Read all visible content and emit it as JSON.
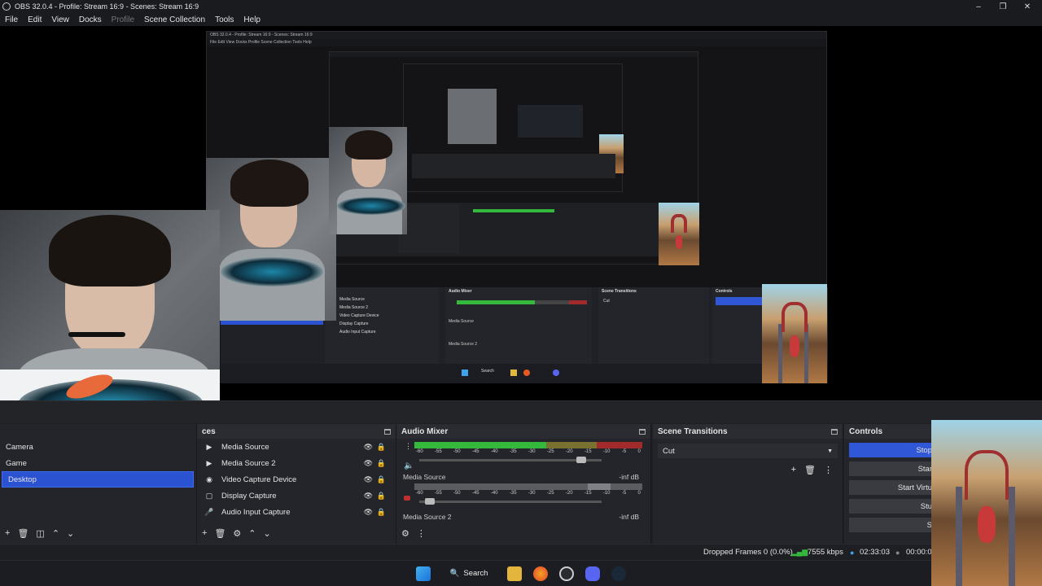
{
  "window": {
    "title": "OBS 32.0.4 - Profile: Stream 16:9 - Scenes: Stream 16:9"
  },
  "menu": [
    "File",
    "Edit",
    "View",
    "Docks",
    "Profile",
    "Scene Collection",
    "Tools",
    "Help"
  ],
  "scenes": {
    "items": [
      "Camera",
      "Game",
      "Desktop"
    ],
    "selected": "Desktop"
  },
  "sources": {
    "title": "ces",
    "items": [
      {
        "icon": "play-icon",
        "label": "Media Source"
      },
      {
        "icon": "play-icon",
        "label": "Media Source 2"
      },
      {
        "icon": "camera-icon",
        "label": "Video Capture Device"
      },
      {
        "icon": "monitor-icon",
        "label": "Display Capture"
      },
      {
        "icon": "mic-icon",
        "label": "Audio Input Capture"
      }
    ]
  },
  "audio_mixer": {
    "title": "Audio Mixer",
    "scale": [
      "-60",
      "-55",
      "-50",
      "-45",
      "-40",
      "-35",
      "-30",
      "-25",
      "-20",
      "-15",
      "-10",
      "-5",
      "0"
    ],
    "channels": [
      {
        "name": "",
        "level_db": "",
        "meter_fraction": 0.58,
        "volume_fraction": 0.86
      },
      {
        "name": "Media Source",
        "level_db": "-inf dB",
        "meter_fraction": 0.0,
        "volume_fraction": 0.03
      },
      {
        "name": "Media Source 2",
        "level_db": "-inf dB",
        "meter_fraction": 0.0,
        "volume_fraction": 0.0
      }
    ]
  },
  "scene_transitions": {
    "title": "Scene Transitions",
    "selected": "Cut"
  },
  "controls": {
    "title": "Controls",
    "buttons": [
      "Stop",
      "Star",
      "Start Virtu",
      "Stu",
      "S"
    ]
  },
  "status": {
    "dropped_frames": "Dropped Frames 0 (0.0%)",
    "bitrate": "7555 kbps",
    "stream_time": "02:33:03",
    "record_time": "00:00:00"
  },
  "taskbar": {
    "search_label": "Search"
  },
  "nested_title": "OBS 32.0.4 - Profile: Stream 16:9 - Scenes: Stream 16:9",
  "nested_menu": "File  Edit  View  Docks  Profile  Scene Collection  Tools  Help"
}
